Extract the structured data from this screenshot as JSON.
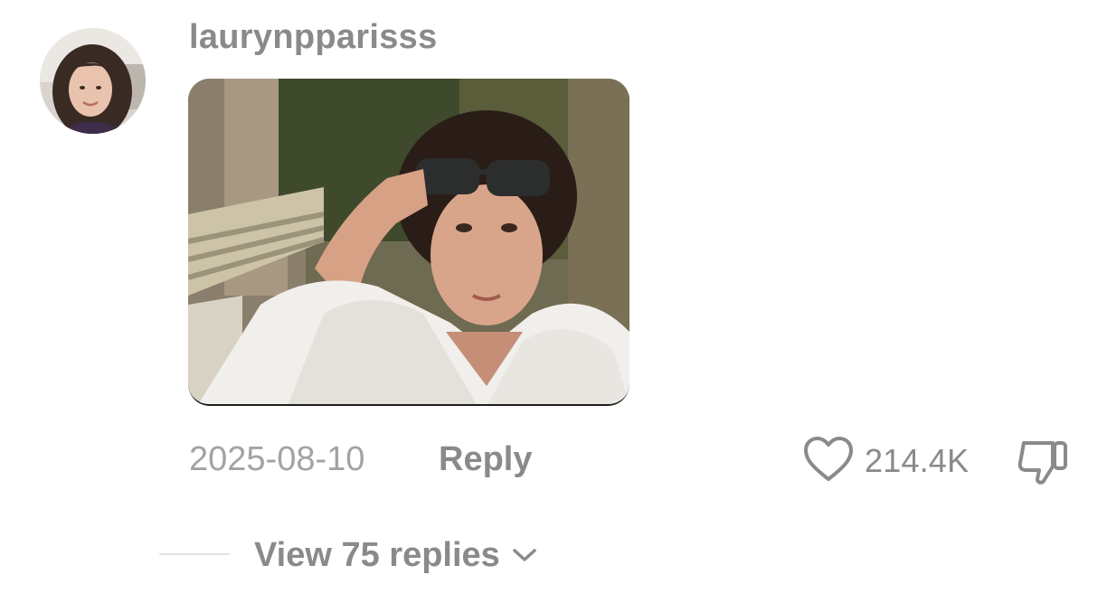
{
  "comment": {
    "username": "laurynpparisss",
    "date": "2025-08-10",
    "reply_label": "Reply",
    "like_count": "214.4K",
    "view_replies_label": "View 75 replies"
  },
  "icons": {
    "like": "heart-outline-icon",
    "dislike": "thumbs-down-outline-icon",
    "expand": "chevron-down-icon"
  },
  "colors": {
    "primary_text": "#8a8a8a",
    "secondary_text": "#a3a3a3",
    "background": "#ffffff"
  }
}
